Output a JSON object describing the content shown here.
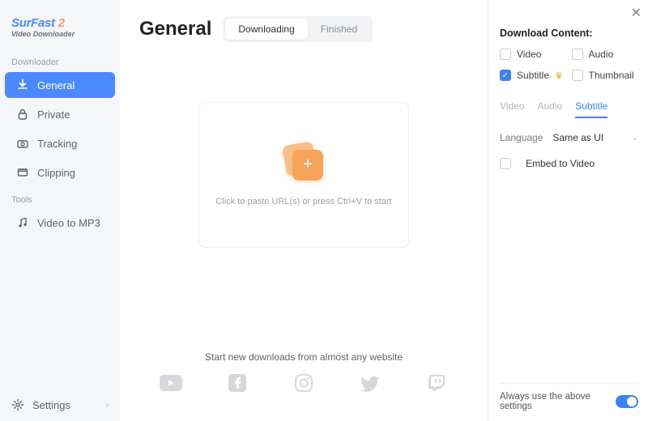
{
  "logo": {
    "brand": "SurFast",
    "version": "2",
    "sub": "Video Downloader"
  },
  "sidebar": {
    "section1": "Downloader",
    "section2": "Tools",
    "items": [
      {
        "label": "General"
      },
      {
        "label": "Private"
      },
      {
        "label": "Tracking"
      },
      {
        "label": "Clipping"
      }
    ],
    "tools": [
      {
        "label": "Video to MP3"
      }
    ],
    "settings": "Settings"
  },
  "main": {
    "title": "General",
    "tabs": {
      "downloading": "Downloading",
      "finished": "Finished"
    },
    "drop_hint": "Click to paste URL(s) or press Ctrl+V to start",
    "site_caption": "Start new downloads from almost any website"
  },
  "panel": {
    "title": "Download Content:",
    "options": {
      "video": "Video",
      "audio": "Audio",
      "subtitle": "Subtitle",
      "thumbnail": "Thumbnail"
    },
    "subtabs": {
      "video": "Video",
      "audio": "Audio",
      "subtitle": "Subtitle"
    },
    "language_label": "Language",
    "language_value": "Same as UI",
    "embed": "Embed to Video",
    "footer": "Always use the above settings"
  }
}
